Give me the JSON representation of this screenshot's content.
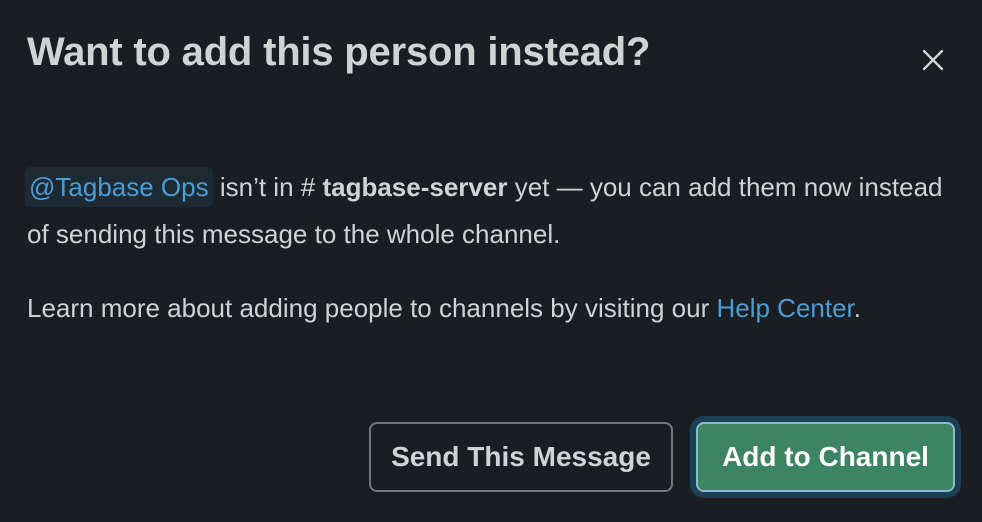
{
  "dialog": {
    "title": "Want to add this person instead?",
    "close_icon": "close-icon"
  },
  "message": {
    "mention": "@Tagbase Ops",
    "text_before_channel": " isn’t in ",
    "hash_symbol": "#",
    "channel_name": "tagbase-server",
    "text_after_channel": " yet — you can add them now instead of sending this message to the whole channel."
  },
  "help": {
    "text_before_link": "Learn more about adding people to channels by visiting our ",
    "link_label": "Help Center",
    "text_after_link": "."
  },
  "actions": {
    "send_label": "Send This Message",
    "add_label": "Add to Channel"
  },
  "colors": {
    "background": "#1a1d21",
    "link": "#4a9ed6",
    "primary_button": "#3d8463"
  }
}
